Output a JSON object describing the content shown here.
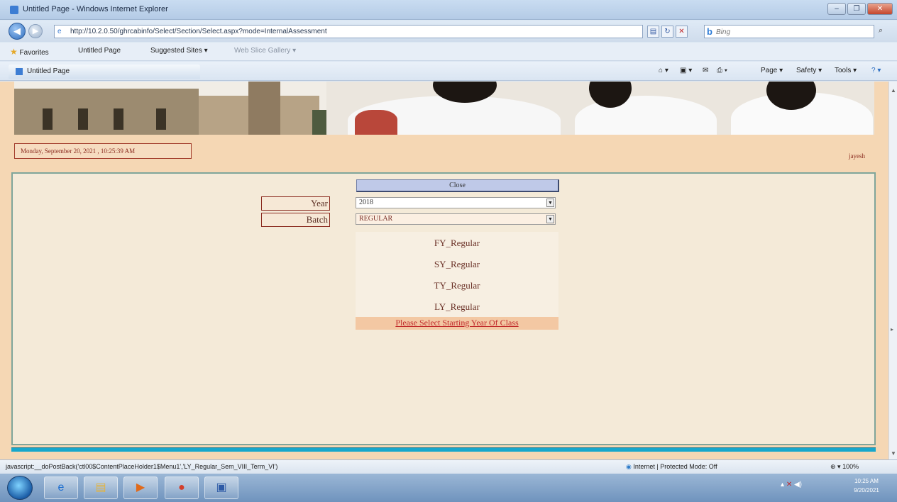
{
  "window": {
    "title": "Untitled Page - Windows Internet Explorer",
    "controls": [
      "–",
      "❐",
      "✕"
    ]
  },
  "address": {
    "url": "http://10.2.0.50/ghrcabinfo/Select/Section/Select.aspx?mode=InternalAssessment",
    "search_placeholder": "Bing"
  },
  "favorites": {
    "label": "Favorites",
    "items": [
      "Untitled Page",
      "Suggested Sites ▾",
      "Web Slice Gallery ▾"
    ]
  },
  "tab": {
    "title": "Untitled Page"
  },
  "commands": [
    "Page ▾",
    "Safety ▾",
    "Tools ▾"
  ],
  "page": {
    "datetime": "Monday, September 20, 2021 , 10:25:39 AM",
    "user": "jayesh",
    "close_label": "Close",
    "year_label": "Year",
    "year_value": "2018",
    "batch_label": "Batch",
    "batch_value": "REGULAR",
    "menu_items": [
      "FY_Regular",
      "SY_Regular",
      "TY_Regular",
      "LY_Regular"
    ],
    "hint": "Please Select Starting Year Of Class"
  },
  "status": {
    "text": "javascript:__doPostBack('ctl00$ContentPlaceHolder1$Menu1','LY_Regular_Sem_VIII_Term_VI')",
    "zone": "Internet | Protected Mode: Off",
    "zoom": "100%"
  },
  "taskbar": {
    "clock_time": "10:25 AM",
    "clock_date": "9/20/2021"
  }
}
